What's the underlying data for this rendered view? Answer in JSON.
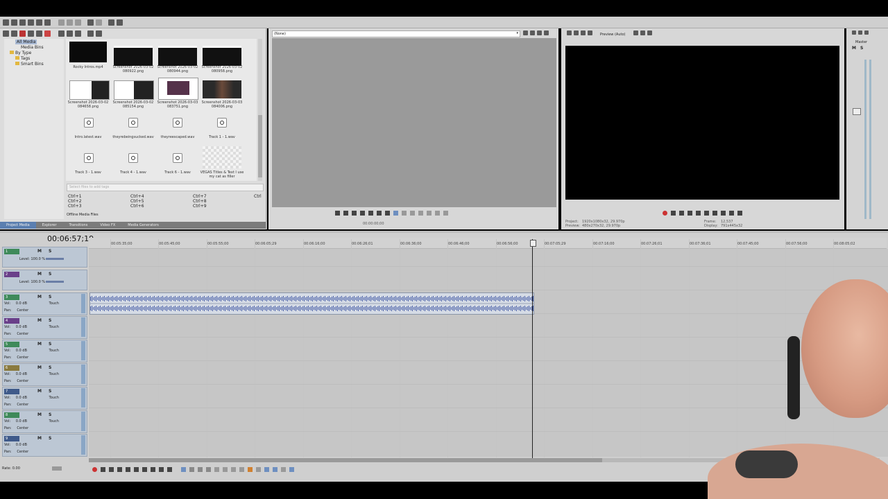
{
  "toolbar": {
    "icons": [
      "new-icon",
      "open-icon",
      "save-icon",
      "render-icon",
      "properties-icon",
      "settings-icon",
      "cut-icon",
      "copy-icon",
      "paste-icon",
      "undo-icon",
      "redo-icon",
      "fx-icon",
      "help-icon"
    ]
  },
  "media_tree": {
    "items": [
      {
        "label": "All Media",
        "selected": true
      },
      {
        "label": "Media Bins",
        "selected": false
      },
      {
        "label": "By Type",
        "selected": false
      },
      {
        "label": "Tags",
        "selected": false
      },
      {
        "label": "Smart Bins",
        "selected": false
      }
    ]
  },
  "media_files": [
    {
      "label": "Rocky Intros.mp4",
      "type": "video"
    },
    {
      "label": "Screenshot 2026-03-02 080922.png",
      "type": "image"
    },
    {
      "label": "Screenshot 2026-03-02 080944.png",
      "type": "image"
    },
    {
      "label": "Screenshot 2026-03-02 080958.png",
      "type": "image"
    },
    {
      "label": "Screenshot 2026-03-02 084658.png",
      "type": "image"
    },
    {
      "label": "Screenshot 2026-03-02 085154.png",
      "type": "image"
    },
    {
      "label": "Screenshot 2026-03-03 083751.png",
      "type": "image"
    },
    {
      "label": "Screenshot 2026-03-03 084006.png",
      "type": "image"
    },
    {
      "label": "Intro.latest.wav",
      "type": "audio"
    },
    {
      "label": "theyrebeingsucked.wav",
      "type": "audio"
    },
    {
      "label": "theyreescaped.wav",
      "type": "audio"
    },
    {
      "label": "Track 1 - 1.wav",
      "type": "audio"
    },
    {
      "label": "Track 3 - 1.wav",
      "type": "audio"
    },
    {
      "label": "Track 4 - 1.wav",
      "type": "audio"
    },
    {
      "label": "Track 6 - 1.wav",
      "type": "audio"
    },
    {
      "label": "VEGAS Titles & Text I use my cat as filler",
      "type": "title"
    }
  ],
  "media_search": {
    "placeholder": "Select files to add tags"
  },
  "shortcuts": [
    [
      "Ctrl+1",
      "Ctrl+4",
      "Ctrl+7",
      "Ctrl"
    ],
    [
      "Ctrl+2",
      "Ctrl+5",
      "Ctrl+8",
      ""
    ],
    [
      "Ctrl+3",
      "Ctrl+6",
      "Ctrl+9",
      ""
    ]
  ],
  "offline_label": "Offline Media Files",
  "bottom_tabs": [
    "Project Media",
    "Explorer",
    "Transitions",
    "Video FX",
    "Media Generators"
  ],
  "trimmer": {
    "dropdown_value": "(None)",
    "timecode": "00:00:00;00"
  },
  "preview": {
    "mode": "Preview (Auto)",
    "project_label": "Project:",
    "project_value": "1920x1080x32, 29.970p",
    "preview_label": "Preview:",
    "preview_value": "480x270x32, 29.970p",
    "frame_label": "Frame:",
    "frame_value": "12,537",
    "display_label": "Display:",
    "display_value": "791x445x32"
  },
  "master": {
    "label": "Master"
  },
  "timeline": {
    "timecode": "00:06:57;19",
    "ticks": [
      "00:05:35;00",
      "00:05:45;00",
      "00:05:55;00",
      "00:06:05;29",
      "00:06:16;00",
      "00:06:26;01",
      "00:06:36;00",
      "00:06:46;00",
      "00:06:56;00",
      "00:07:05;29",
      "00:07:16;00",
      "00:07:26;01",
      "00:07:36;01",
      "00:07:45;00",
      "00:07:56;00",
      "00:08:05;02"
    ],
    "rate_label": "Rate: 0.00",
    "video_tracks": [
      {
        "num": "1",
        "level": "Level: 100.0 %"
      },
      {
        "num": "2",
        "level": "Level: 100.0 %"
      }
    ],
    "audio_tracks": [
      {
        "num": "3",
        "vol": "Vol:",
        "vol_value": "0.0 dB",
        "pan": "Pan:",
        "pan_value": "Center",
        "mode": "Touch"
      },
      {
        "num": "4",
        "vol": "Vol:",
        "vol_value": "0.0 dB",
        "pan": "Pan:",
        "pan_value": "Center",
        "mode": "Touch"
      },
      {
        "num": "5",
        "vol": "Vol:",
        "vol_value": "0.0 dB",
        "pan": "Pan:",
        "pan_value": "Center",
        "mode": "Touch"
      },
      {
        "num": "6",
        "vol": "Vol:",
        "vol_value": "0.0 dB",
        "pan": "Pan:",
        "pan_value": "Center",
        "mode": "Touch"
      },
      {
        "num": "7",
        "vol": "Vol:",
        "vol_value": "0.0 dB",
        "pan": "Pan:",
        "pan_value": "Center",
        "mode": "Touch"
      },
      {
        "num": "8",
        "vol": "Vol:",
        "vol_value": "0.0 dB",
        "pan": "Pan:",
        "pan_value": "Center",
        "mode": "Touch"
      },
      {
        "num": "9",
        "vol": "Vol:",
        "vol_value": "0.0 dB",
        "pan": "Pan:",
        "pan_value": "Center",
        "mode": "Touch"
      }
    ],
    "msb": "M S"
  },
  "colors": {
    "accent_blue": "#5b7fb0",
    "track_header": "#bcc7d4",
    "panel_bg": "#d9d9d9",
    "timeline_bg": "#c9c9c9",
    "audio_clip": "#d5dbe5",
    "wave": "#4a60a8"
  }
}
